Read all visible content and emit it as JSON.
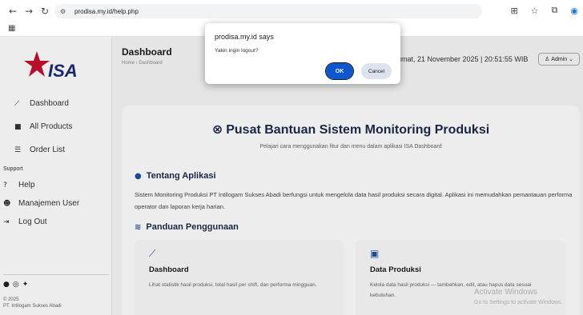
{
  "browser": {
    "url": "prodisa.my.id/help.php",
    "back_icon": "arrow-left-icon",
    "forward_icon": "arrow-right-icon",
    "reload_icon": "reload-icon"
  },
  "sidebar": {
    "logo_text": "ISA",
    "items": [
      {
        "label": "Dashboard",
        "icon": "chart-line-icon"
      },
      {
        "label": "All Products",
        "icon": "box-icon"
      },
      {
        "label": "Order List",
        "icon": "list-icon"
      }
    ],
    "support_label": "Support",
    "support_items": [
      {
        "label": "Help",
        "icon": "question-circle-icon"
      },
      {
        "label": "Manajemen User",
        "icon": "users-icon"
      },
      {
        "label": "Log Out",
        "icon": "sign-out-icon"
      }
    ],
    "footer_year": "© 2025",
    "footer_company": "PT. Intilogam Sukses Abadi"
  },
  "header": {
    "title": "Dashboard",
    "breadcrumb": "Home › Dashboard",
    "datetime": "umat, 21 November 2025 | 20:51:55 WIB",
    "admin_label": "Admin"
  },
  "help": {
    "title": "Pusat Bantuan Sistem Monitoring Produksi",
    "subtitle": "Pelajari cara menggunakan fitur dan menu dalam aplikasi ISA Dashboard",
    "about_title": "Tentang Aplikasi",
    "about_text": "Sistem Monitoring Produksi PT Intilogam Sukses Abadi berfungsi untuk mengelola data hasil produksi secara digital. Aplikasi ini memudahkan pemantauan performa operator dan laporan kerja harian.",
    "guide_title": "Panduan Penggunaan",
    "guides": [
      {
        "title": "Dashboard",
        "desc": "Lihat statistik hasil produksi, total hasil per shift, dan performa mingguan.",
        "icon": "chart-line-icon"
      },
      {
        "title": "Data Produksi",
        "desc": "Kelola data hasil produksi — tambahkan, edit, atau hapus data sesuai kebutuhan.",
        "icon": "boxes-icon"
      }
    ]
  },
  "dialog": {
    "title": "prodisa.my.id says",
    "message": "Yakin ingin logout?",
    "ok_label": "OK",
    "cancel_label": "Cancel"
  },
  "watermark": {
    "line1": "Activate Windows",
    "line2": "Go to Settings to activate Windows."
  },
  "colors": {
    "accent": "#0b57d0",
    "heading": "#1c2a4a",
    "logo_red": "#c8102e"
  }
}
